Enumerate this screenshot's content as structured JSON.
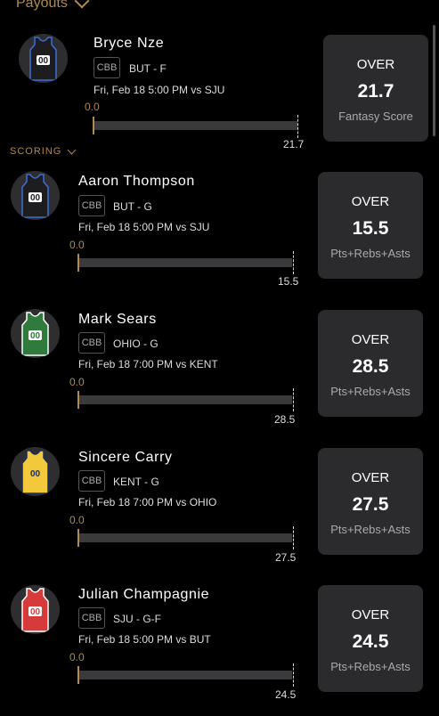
{
  "header": {
    "title": "Payouts"
  },
  "scoring_label": "SCORING",
  "players": [
    {
      "name": "Bryce Nze",
      "league": "CBB",
      "team_pos": "BUT - F",
      "game": "Fri, Feb 18 5:00 PM vs SJU",
      "zero": "0.0",
      "line": "21.7",
      "pick": "OVER",
      "stat": "Fantasy Score",
      "jersey_color": "#1d1d20",
      "trim_color": "#3b6fd6",
      "jersey_number": "00"
    },
    {
      "name": "Aaron Thompson",
      "league": "CBB",
      "team_pos": "BUT - G",
      "game": "Fri, Feb 18 5:00 PM vs SJU",
      "zero": "0.0",
      "line": "15.5",
      "pick": "OVER",
      "stat": "Pts+Rebs+Asts",
      "jersey_color": "#1d1d20",
      "trim_color": "#3b6fd6",
      "jersey_number": "00"
    },
    {
      "name": "Mark Sears",
      "league": "CBB",
      "team_pos": "OHIO - G",
      "game": "Fri, Feb 18 7:00 PM vs KENT",
      "zero": "0.0",
      "line": "28.5",
      "pick": "OVER",
      "stat": "Pts+Rebs+Asts",
      "jersey_color": "#2f7a3c",
      "trim_color": "#ffffff",
      "jersey_number": "00"
    },
    {
      "name": "Sincere Carry",
      "league": "CBB",
      "team_pos": "KENT - G",
      "game": "Fri, Feb 18 7:00 PM vs OHIO",
      "zero": "0.0",
      "line": "27.5",
      "pick": "OVER",
      "stat": "Pts+Rebs+Asts",
      "jersey_color": "#f1c93b",
      "trim_color": "#1a2d5a",
      "jersey_number": "00"
    },
    {
      "name": "Julian Champagnie",
      "league": "CBB",
      "team_pos": "SJU - G-F",
      "game": "Fri, Feb 18 5:00 PM vs BUT",
      "zero": "0.0",
      "line": "24.5",
      "pick": "OVER",
      "stat": "Pts+Rebs+Asts",
      "jersey_color": "#d63a3a",
      "trim_color": "#ffffff",
      "jersey_number": "00"
    }
  ]
}
